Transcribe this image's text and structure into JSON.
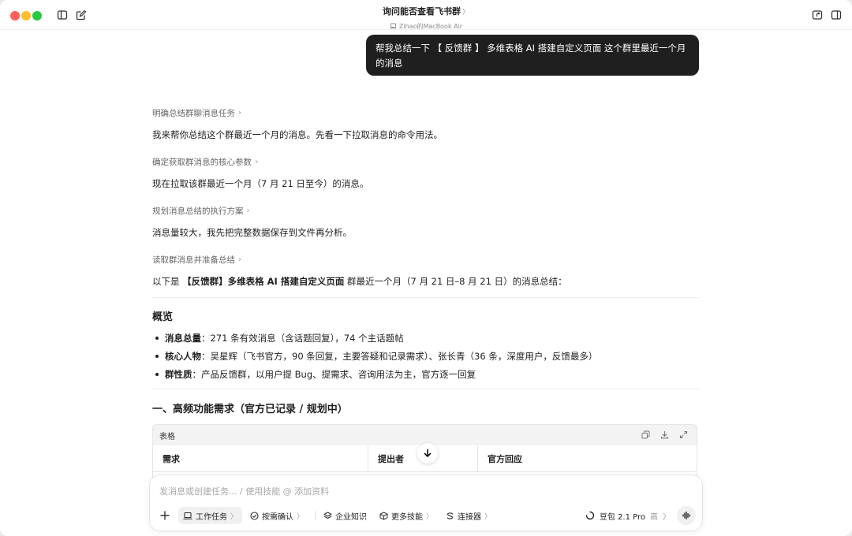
{
  "window": {
    "title": "询问能否查看飞书群",
    "title_chevron": "〉",
    "subtitle": "Zihao的MacBook Air"
  },
  "user_message": "帮我总结一下 【 反馈群 】 多维表格 AI 搭建自定义页面 这个群里最近一个月的消息",
  "steps": [
    {
      "label": "明确总结群聊消息任务",
      "text": "我来帮你总结这个群最近一个月的消息。先看一下拉取消息的命令用法。"
    },
    {
      "label": "确定获取群消息的核心参数",
      "text": "现在拉取该群最近一个月（7 月 21 日至今）的消息。"
    },
    {
      "label": "规划消息总结的执行方案",
      "text": "消息量较大，我先把完整数据保存到文件再分析。"
    },
    {
      "label": "读取群消息并准备总结",
      "text": ""
    }
  ],
  "summary_intro": {
    "prefix": "以下是 ",
    "bold": "【反馈群】多维表格 AI 搭建自定义页面",
    "suffix": " 群最近一个月（7 月 21 日–8 月 21 日）的消息总结："
  },
  "overview": {
    "heading": "概览",
    "items": [
      {
        "label": "消息总量",
        "text": "：271 条有效消息（含话题回复），74 个主话题帖"
      },
      {
        "label": "核心人物",
        "text": "：吴星辉（飞书官方，90 条回复，主要答疑和记录需求）、张长青（36 条，深度用户，反馈最多）"
      },
      {
        "label": "群性质",
        "text": "：产品反馈群，以用户提 Bug、提需求、咨询用法为主，官方逐一回复"
      }
    ]
  },
  "section1": {
    "heading": "一、高频功能需求（官方已记录 / 规划中）",
    "table_label": "表格",
    "columns": [
      "需求",
      "提出者",
      "官方回应"
    ]
  },
  "composer": {
    "placeholder": "发消息或创建任务... / 使用技能 @ 添加资料",
    "chips": [
      {
        "label": "工作任务",
        "chevron": "〉"
      },
      {
        "label": "按需确认",
        "chevron": "〉"
      },
      {
        "label": "企业知识",
        "chevron": ""
      },
      {
        "label": "更多技能",
        "chevron": "〉"
      },
      {
        "label": "连接器",
        "chevron": "〉"
      }
    ],
    "model": "豆包 2.1 Pro",
    "model_level": "高",
    "model_chevron": "〉"
  }
}
